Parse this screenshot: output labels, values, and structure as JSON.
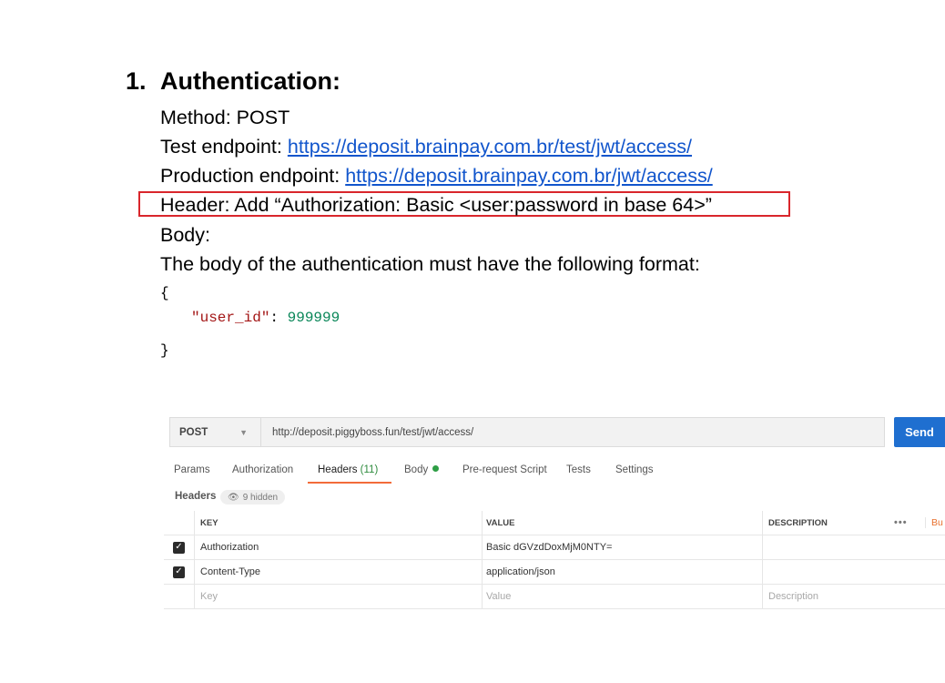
{
  "doc": {
    "section_number": "1.",
    "section_title": "Authentication:",
    "method_line": "Method: POST",
    "test_label": "Test endpoint: ",
    "test_url": "https://deposit.brainpay.com.br/test/jwt/access/",
    "prod_label": "Production endpoint: ",
    "prod_url": "https://deposit.brainpay.com.br/jwt/access/",
    "header_line": "Header: Add “Authorization: Basic <user:password in base 64>”",
    "body_label": "Body:",
    "body_desc": "The body of the authentication must have the following format:",
    "code_open": "{",
    "code_key": "\"user_id\"",
    "code_sep": ": ",
    "code_value": "999999",
    "code_close": "}",
    "highlight_color": "#d9262c"
  },
  "postman": {
    "method": "POST",
    "url": "http://deposit.piggyboss.fun/test/jwt/access/",
    "send_label": "Send",
    "tabs": [
      {
        "label": "Params"
      },
      {
        "label": "Authorization"
      },
      {
        "label": "Headers",
        "count": "(11)"
      },
      {
        "label": "Body"
      },
      {
        "label": "Pre-request Script"
      },
      {
        "label": "Tests"
      },
      {
        "label": "Settings"
      }
    ],
    "headers_label": "Headers",
    "hidden_label": "9 hidden",
    "columns": {
      "key": "KEY",
      "value": "VALUE",
      "description": "DESCRIPTION",
      "bulk": "Bu"
    },
    "rows": [
      {
        "key": "Authorization",
        "value": "Basic dGVzdDoxMjM0NTY=",
        "checked": true
      },
      {
        "key": "Content-Type",
        "value": "application/json",
        "checked": true
      }
    ],
    "placeholders": {
      "key": "Key",
      "value": "Value",
      "description": "Description"
    },
    "accent_color": "#f26b3a",
    "send_color": "#1f6fd0"
  }
}
